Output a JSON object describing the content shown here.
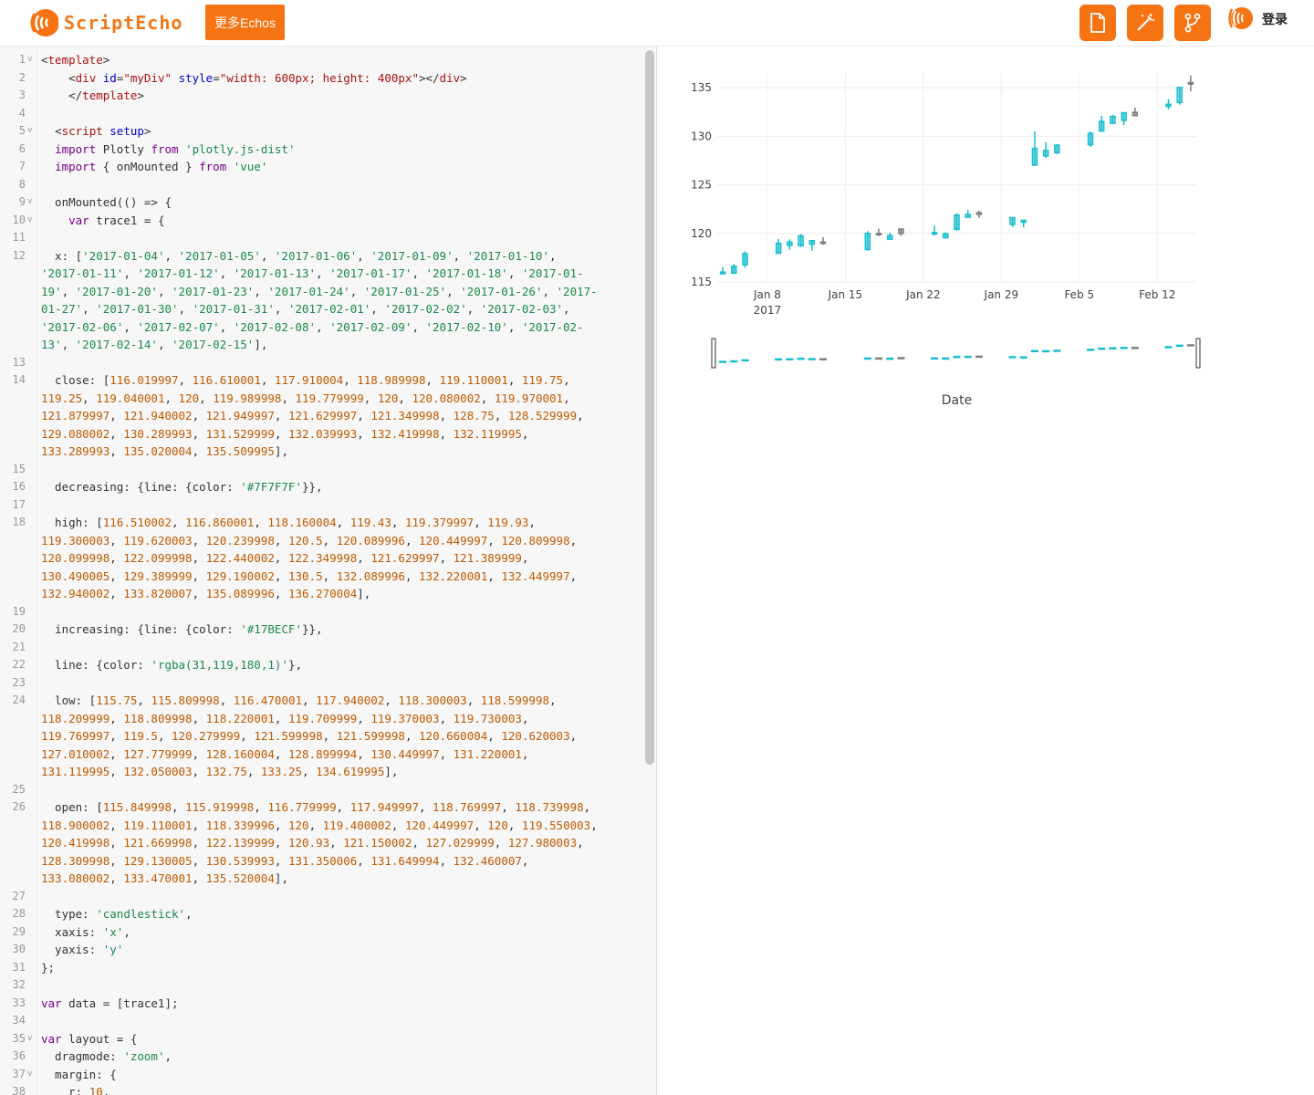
{
  "header": {
    "logo_text": "ScriptEcho",
    "more_button": "更多Echos",
    "tools": [
      {
        "icon": "document-icon"
      },
      {
        "icon": "magic-wand-icon"
      },
      {
        "icon": "git-branch-icon"
      }
    ],
    "login_label": "登录"
  },
  "editor": {
    "lines": [
      {
        "n": "1",
        "fold": true,
        "html": "<span class='pun'>&lt;</span><span class='tag'>template</span><span class='pun'>&gt;</span>"
      },
      {
        "n": "2",
        "html": "    <span class='pun'>&lt;</span><span class='tag'>div</span> <span class='at'>id</span>=<span class='st'>\"myDiv\"</span> <span class='at'>style</span>=<span class='st'>\"width: 600px; height: 400px\"</span><span class='pun'>&gt;&lt;/</span><span class='tag'>div</span><span class='pun'>&gt;</span>"
      },
      {
        "n": "3",
        "html": "    <span class='pun'>&lt;/</span><span class='tag'>template</span><span class='pun'>&gt;</span>"
      },
      {
        "n": "4",
        "html": ""
      },
      {
        "n": "5",
        "fold": true,
        "html": "  <span class='pun'>&lt;</span><span class='tag'>script</span> <span class='at'>setup</span><span class='pun'>&gt;</span>"
      },
      {
        "n": "6",
        "html": "  <span class='kw'>import</span> Plotly <span class='kw'>from</span> <span class='str'>'plotly.js-dist'</span>"
      },
      {
        "n": "7",
        "html": "  <span class='kw'>import</span> { onMounted } <span class='kw'>from</span> <span class='str'>'vue'</span>"
      },
      {
        "n": "8",
        "html": ""
      },
      {
        "n": "9",
        "fold": true,
        "html": "  onMounted(() =&gt; {"
      },
      {
        "n": "10",
        "fold": true,
        "html": "    <span class='kw'>var</span> trace1 = {"
      },
      {
        "n": "11",
        "html": ""
      },
      {
        "n": "12",
        "html": "  x: [<span class='str'>'2017-01-04'</span>, <span class='str'>'2017-01-05'</span>, <span class='str'>'2017-01-06'</span>, <span class='str'>'2017-01-09'</span>, <span class='str'>'2017-01-10'</span>,"
      },
      {
        "n": "",
        "html": "<span class='str'>'2017-01-11'</span>, <span class='str'>'2017-01-12'</span>, <span class='str'>'2017-01-13'</span>, <span class='str'>'2017-01-17'</span>, <span class='str'>'2017-01-18'</span>, <span class='str'>'2017-01-</span>"
      },
      {
        "n": "",
        "html": "<span class='str'>19'</span>, <span class='str'>'2017-01-20'</span>, <span class='str'>'2017-01-23'</span>, <span class='str'>'2017-01-24'</span>, <span class='str'>'2017-01-25'</span>, <span class='str'>'2017-01-26'</span>, <span class='str'>'2017-</span>"
      },
      {
        "n": "",
        "html": "<span class='str'>01-27'</span>, <span class='str'>'2017-01-30'</span>, <span class='str'>'2017-01-31'</span>, <span class='str'>'2017-02-01'</span>, <span class='str'>'2017-02-02'</span>, <span class='str'>'2017-02-03'</span>,"
      },
      {
        "n": "",
        "html": "<span class='str'>'2017-02-06'</span>, <span class='str'>'2017-02-07'</span>, <span class='str'>'2017-02-08'</span>, <span class='str'>'2017-02-09'</span>, <span class='str'>'2017-02-10'</span>, <span class='str'>'2017-02-</span>"
      },
      {
        "n": "",
        "html": "<span class='str'>13'</span>, <span class='str'>'2017-02-14'</span>, <span class='str'>'2017-02-15'</span>],"
      },
      {
        "n": "13",
        "html": ""
      },
      {
        "n": "14",
        "html": "  close: [<span class='num'>116.019997</span>, <span class='num'>116.610001</span>, <span class='num'>117.910004</span>, <span class='num'>118.989998</span>, <span class='num'>119.110001</span>, <span class='num'>119.75</span>,"
      },
      {
        "n": "",
        "html": "<span class='num'>119.25</span>, <span class='num'>119.040001</span>, <span class='num'>120</span>, <span class='num'>119.989998</span>, <span class='num'>119.779999</span>, <span class='num'>120</span>, <span class='num'>120.080002</span>, <span class='num'>119.970001</span>,"
      },
      {
        "n": "",
        "html": "<span class='num'>121.879997</span>, <span class='num'>121.940002</span>, <span class='num'>121.949997</span>, <span class='num'>121.629997</span>, <span class='num'>121.349998</span>, <span class='num'>128.75</span>, <span class='num'>128.529999</span>,"
      },
      {
        "n": "",
        "html": "<span class='num'>129.080002</span>, <span class='num'>130.289993</span>, <span class='num'>131.529999</span>, <span class='num'>132.039993</span>, <span class='num'>132.419998</span>, <span class='num'>132.119995</span>,"
      },
      {
        "n": "",
        "html": "<span class='num'>133.289993</span>, <span class='num'>135.020004</span>, <span class='num'>135.509995</span>],"
      },
      {
        "n": "15",
        "html": ""
      },
      {
        "n": "16",
        "html": "  decreasing: {line: {color: <span class='str'>'#7F7F7F'</span>}},"
      },
      {
        "n": "17",
        "html": ""
      },
      {
        "n": "18",
        "html": "  high: [<span class='num'>116.510002</span>, <span class='num'>116.860001</span>, <span class='num'>118.160004</span>, <span class='num'>119.43</span>, <span class='num'>119.379997</span>, <span class='num'>119.93</span>,"
      },
      {
        "n": "",
        "html": "<span class='num'>119.300003</span>, <span class='num'>119.620003</span>, <span class='num'>120.239998</span>, <span class='num'>120.5</span>, <span class='num'>120.089996</span>, <span class='num'>120.449997</span>, <span class='num'>120.809998</span>,"
      },
      {
        "n": "",
        "html": "<span class='num'>120.099998</span>, <span class='num'>122.099998</span>, <span class='num'>122.440002</span>, <span class='num'>122.349998</span>, <span class='num'>121.629997</span>, <span class='num'>121.389999</span>,"
      },
      {
        "n": "",
        "html": "<span class='num'>130.490005</span>, <span class='num'>129.389999</span>, <span class='num'>129.190002</span>, <span class='num'>130.5</span>, <span class='num'>132.089996</span>, <span class='num'>132.220001</span>, <span class='num'>132.449997</span>,"
      },
      {
        "n": "",
        "html": "<span class='num'>132.940002</span>, <span class='num'>133.820007</span>, <span class='num'>135.089996</span>, <span class='num'>136.270004</span>],"
      },
      {
        "n": "19",
        "html": ""
      },
      {
        "n": "20",
        "html": "  increasing: {line: {color: <span class='str'>'#17BECF'</span>}},"
      },
      {
        "n": "21",
        "html": ""
      },
      {
        "n": "22",
        "html": "  line: {color: <span class='str'>'rgba(31,119,180,1)'</span>},"
      },
      {
        "n": "23",
        "html": ""
      },
      {
        "n": "24",
        "html": "  low: [<span class='num'>115.75</span>, <span class='num'>115.809998</span>, <span class='num'>116.470001</span>, <span class='num'>117.940002</span>, <span class='num'>118.300003</span>, <span class='num'>118.599998</span>,"
      },
      {
        "n": "",
        "html": "<span class='num'>118.209999</span>, <span class='num'>118.809998</span>, <span class='num'>118.220001</span>, <span class='num'>119.709999</span>, <span class='num'>119.370003</span>, <span class='num'>119.730003</span>,"
      },
      {
        "n": "",
        "html": "<span class='num'>119.769997</span>, <span class='num'>119.5</span>, <span class='num'>120.279999</span>, <span class='num'>121.599998</span>, <span class='num'>121.599998</span>, <span class='num'>120.660004</span>, <span class='num'>120.620003</span>,"
      },
      {
        "n": "",
        "html": "<span class='num'>127.010002</span>, <span class='num'>127.779999</span>, <span class='num'>128.160004</span>, <span class='num'>128.899994</span>, <span class='num'>130.449997</span>, <span class='num'>131.220001</span>,"
      },
      {
        "n": "",
        "html": "<span class='num'>131.119995</span>, <span class='num'>132.050003</span>, <span class='num'>132.75</span>, <span class='num'>133.25</span>, <span class='num'>134.619995</span>],"
      },
      {
        "n": "25",
        "html": ""
      },
      {
        "n": "26",
        "html": "  open: [<span class='num'>115.849998</span>, <span class='num'>115.919998</span>, <span class='num'>116.779999</span>, <span class='num'>117.949997</span>, <span class='num'>118.769997</span>, <span class='num'>118.739998</span>,"
      },
      {
        "n": "",
        "html": "<span class='num'>118.900002</span>, <span class='num'>119.110001</span>, <span class='num'>118.339996</span>, <span class='num'>120</span>, <span class='num'>119.400002</span>, <span class='num'>120.449997</span>, <span class='num'>120</span>, <span class='num'>119.550003</span>,"
      },
      {
        "n": "",
        "html": "<span class='num'>120.419998</span>, <span class='num'>121.669998</span>, <span class='num'>122.139999</span>, <span class='num'>120.93</span>, <span class='num'>121.150002</span>, <span class='num'>127.029999</span>, <span class='num'>127.980003</span>,"
      },
      {
        "n": "",
        "html": "<span class='num'>128.309998</span>, <span class='num'>129.130005</span>, <span class='num'>130.539993</span>, <span class='num'>131.350006</span>, <span class='num'>131.649994</span>, <span class='num'>132.460007</span>,"
      },
      {
        "n": "",
        "html": "<span class='num'>133.080002</span>, <span class='num'>133.470001</span>, <span class='num'>135.520004</span>],"
      },
      {
        "n": "27",
        "html": ""
      },
      {
        "n": "28",
        "html": "  type: <span class='str'>'candlestick'</span>,"
      },
      {
        "n": "29",
        "html": "  xaxis: <span class='str'>'x'</span>,"
      },
      {
        "n": "30",
        "html": "  yaxis: <span class='str'>'y'</span>"
      },
      {
        "n": "31",
        "html": "};"
      },
      {
        "n": "32",
        "html": ""
      },
      {
        "n": "33",
        "html": "<span class='kw'>var</span> data = [trace1];"
      },
      {
        "n": "34",
        "html": ""
      },
      {
        "n": "35",
        "fold": true,
        "html": "<span class='kw'>var</span> layout = {"
      },
      {
        "n": "36",
        "html": "  dragmode: <span class='str'>'zoom'</span>,"
      },
      {
        "n": "37",
        "fold": true,
        "html": "  margin: {"
      },
      {
        "n": "38",
        "html": "    r: <span class='num'>10</span>,"
      }
    ]
  },
  "chart_data": {
    "type": "candlestick",
    "x": [
      "2017-01-04",
      "2017-01-05",
      "2017-01-06",
      "2017-01-09",
      "2017-01-10",
      "2017-01-11",
      "2017-01-12",
      "2017-01-13",
      "2017-01-17",
      "2017-01-18",
      "2017-01-19",
      "2017-01-20",
      "2017-01-23",
      "2017-01-24",
      "2017-01-25",
      "2017-01-26",
      "2017-01-27",
      "2017-01-30",
      "2017-01-31",
      "2017-02-01",
      "2017-02-02",
      "2017-02-03",
      "2017-02-06",
      "2017-02-07",
      "2017-02-08",
      "2017-02-09",
      "2017-02-10",
      "2017-02-13",
      "2017-02-14",
      "2017-02-15"
    ],
    "open": [
      115.849998,
      115.919998,
      116.779999,
      117.949997,
      118.769997,
      118.739998,
      118.900002,
      119.110001,
      118.339996,
      120,
      119.400002,
      120.449997,
      120,
      119.550003,
      120.419998,
      121.669998,
      122.139999,
      120.93,
      121.150002,
      127.029999,
      127.980003,
      128.309998,
      129.130005,
      130.539993,
      131.350006,
      131.649994,
      132.460007,
      133.080002,
      133.470001,
      135.520004
    ],
    "high": [
      116.510002,
      116.860001,
      118.160004,
      119.43,
      119.379997,
      119.93,
      119.300003,
      119.620003,
      120.239998,
      120.5,
      120.089996,
      120.449997,
      120.809998,
      120.099998,
      122.099998,
      122.440002,
      122.349998,
      121.629997,
      121.389999,
      130.490005,
      129.389999,
      129.190002,
      130.5,
      132.089996,
      132.220001,
      132.449997,
      132.940002,
      133.820007,
      135.089996,
      136.270004
    ],
    "low": [
      115.75,
      115.809998,
      116.470001,
      117.940002,
      118.300003,
      118.599998,
      118.209999,
      118.809998,
      118.220001,
      119.709999,
      119.370003,
      119.730003,
      119.769997,
      119.5,
      120.279999,
      121.599998,
      121.599998,
      120.660004,
      120.620003,
      127.010002,
      127.779999,
      128.160004,
      128.899994,
      130.449997,
      131.220001,
      131.119995,
      132.050003,
      132.75,
      133.25,
      134.619995
    ],
    "close": [
      116.019997,
      116.610001,
      117.910004,
      118.989998,
      119.110001,
      119.75,
      119.25,
      119.040001,
      120,
      119.989998,
      119.779999,
      120,
      120.080002,
      119.970001,
      121.879997,
      121.940002,
      121.949997,
      121.629997,
      121.349998,
      128.75,
      128.529999,
      129.080002,
      130.289993,
      131.529999,
      132.039993,
      132.419998,
      132.119995,
      133.289993,
      135.020004,
      135.509995
    ],
    "increasing_color": "#17BECF",
    "decreasing_color": "#7F7F7F",
    "xlabel": "Date",
    "ylim": [
      115,
      136.7
    ],
    "yticks": [
      "115",
      "120",
      "125",
      "130",
      "135"
    ],
    "xticks": [
      {
        "date": "2017-01-08",
        "label": "Jan 8",
        "sub": "2017"
      },
      {
        "date": "2017-01-15",
        "label": "Jan 15",
        "sub": ""
      },
      {
        "date": "2017-01-22",
        "label": "Jan 22",
        "sub": ""
      },
      {
        "date": "2017-01-29",
        "label": "Jan 29",
        "sub": ""
      },
      {
        "date": "2017-02-05",
        "label": "Feb 5",
        "sub": ""
      },
      {
        "date": "2017-02-12",
        "label": "Feb 12",
        "sub": ""
      }
    ],
    "xrange": [
      "2017-01-03 12:00",
      "2017-02-15 12:00"
    ],
    "grid": true,
    "rangeslider": true
  }
}
